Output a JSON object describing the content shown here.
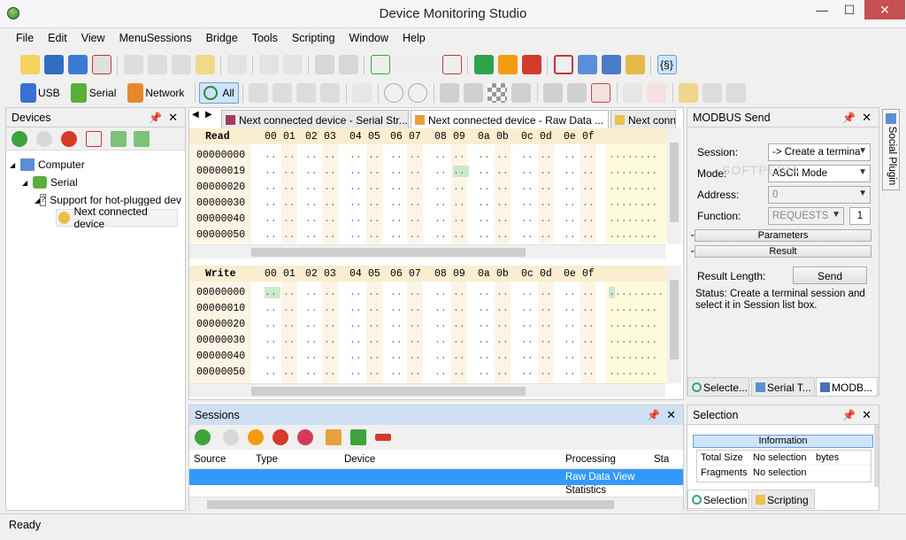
{
  "window": {
    "title": "Device Monitoring Studio",
    "min": "—",
    "max": "☐",
    "close": "✕"
  },
  "menu": [
    "File",
    "Edit",
    "View",
    "MenuSessions",
    "Bridge",
    "Tools",
    "Scripting",
    "Window",
    "Help"
  ],
  "toolbar2": {
    "usb": "USB",
    "serial": "Serial",
    "network": "Network",
    "all": "All"
  },
  "devices": {
    "title": "Devices",
    "tree": [
      {
        "label": "Computer",
        "expander": "◢"
      },
      {
        "label": "Serial",
        "expander": "◢"
      },
      {
        "label": "Support for hot-plugged dev",
        "expander": "◢"
      },
      {
        "label": "Next connected device"
      }
    ]
  },
  "tabs": [
    {
      "label": "Next connected device - Serial Str..."
    },
    {
      "label": "Next connected device - Raw Data ..."
    },
    {
      "label": "Next conn"
    }
  ],
  "hex": {
    "read_label": "Read",
    "write_label": "Write",
    "columns": [
      "00",
      "01",
      "02",
      "03",
      "04",
      "05",
      "06",
      "07",
      "08",
      "09",
      "0a",
      "0b",
      "0c",
      "0d",
      "0e",
      "0f"
    ],
    "read_rows": [
      "00000000",
      "00000019",
      "00000020",
      "00000030",
      "00000040",
      "00000050"
    ],
    "write_rows": [
      "00000000",
      "00000010",
      "00000020",
      "00000030",
      "00000040",
      "00000050"
    ],
    "dots": "..",
    "ascii_dots": "........"
  },
  "sessions": {
    "title": "Sessions",
    "columns": [
      "Source",
      "Type",
      "Device",
      "Processing",
      "Sta"
    ],
    "rows": [
      {
        "processing": "Raw Data View"
      },
      {
        "processing": "Statistics"
      }
    ]
  },
  "modbus": {
    "title": "MODBUS Send",
    "session_label": "Session:",
    "session_value": "-> Create a termina",
    "mode_label": "Mode:",
    "mode_value": "ASCII Mode",
    "address_label": "Address:",
    "address_value": "0",
    "function_label": "Function:",
    "function_value": "REQUESTS",
    "function_num": "1",
    "parameters": "Parameters",
    "result": "Result",
    "result_length_label": "Result Length:",
    "send": "Send",
    "status": "Status: Create a terminal session and select it in Session list box."
  },
  "right_tabs": [
    "Selecte...",
    "Serial T...",
    "MODB..."
  ],
  "side_tab": "Social Plugin",
  "selection": {
    "title": "Selection",
    "information": "Information",
    "rows": [
      {
        "label": "Total Size",
        "value": "No selection",
        "unit": "bytes"
      },
      {
        "label": "Fragments",
        "value": "No selection",
        "unit": ""
      }
    ],
    "bottom_tabs": [
      "Selection",
      "Scripting"
    ]
  },
  "status_bar": "Ready",
  "watermark": "SOFTPEDIA",
  "colors": {
    "accent": "#3399ff",
    "hex_header": "#fbedd0",
    "hex_col": "#fdf4e6",
    "ascii": "#fffbdc",
    "highlight": "#cde8cd"
  }
}
